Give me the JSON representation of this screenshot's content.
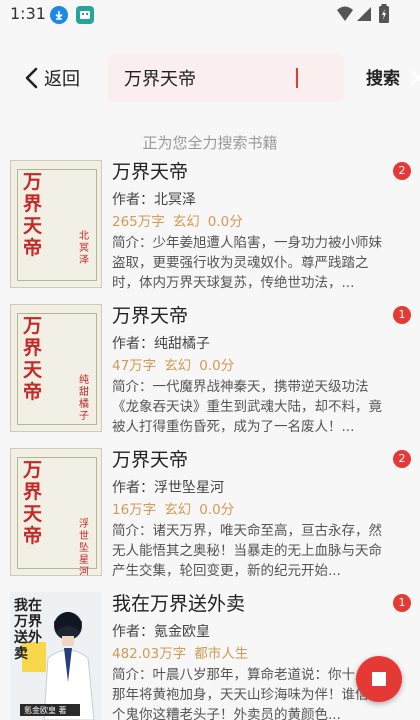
{
  "status_bar": {
    "time": "1:31",
    "icons": [
      "download-icon",
      "app-notification-icon",
      "wifi-icon",
      "signal-icon",
      "battery-icon"
    ]
  },
  "toolbar": {
    "back_label": "返回",
    "search_value": "万界天帝",
    "search_button": "搜索"
  },
  "status_text": "正为您全力搜索书籍",
  "colors": {
    "accent": "#e53935",
    "meta": "#d29a55",
    "search_bg": "#fbeeee"
  },
  "results": [
    {
      "title": "万界天帝",
      "author": "作者：北冥泽",
      "words": "265万字",
      "category": "玄幻",
      "score": "0.0分",
      "summary": "简介：少年姜旭遭人陷害，一身功力被小师妹盗取，更要强行收为灵魂奴仆。尊严践踏之时，体内万界天球复苏，传绝世功法，...",
      "badge": "2",
      "cover_title": "万界天帝",
      "cover_author": "北冥泽"
    },
    {
      "title": "万界天帝",
      "author": "作者：纯甜橘子",
      "words": "47万字",
      "category": "玄幻",
      "score": "0.0分",
      "summary": "简介：一代魔界战神秦天，携带逆天级功法《龙象吞天诀》重生到武魂大陆，却不料，竟被人打得重伤昏死，成为了一名废人！...",
      "badge": "1",
      "cover_title": "万界天帝",
      "cover_author": "纯甜橘子"
    },
    {
      "title": "万界天帝",
      "author": "作者：浮世坠星河",
      "words": "16万字",
      "category": "玄幻",
      "score": "0.0分",
      "summary": "简介：诸天万界，唯天命至高，亘古永存，然无人能悟其之奥秘！当暴走的无上血脉与天命产生交集，轮回变更，新的纪元开始...",
      "badge": "2",
      "cover_title": "万界天帝",
      "cover_author": "浮世坠星河"
    },
    {
      "title": "我在万界送外卖",
      "author": "作者：氪金欧皇",
      "words": "482.03万字",
      "category": "都市人生",
      "score": "",
      "summary": "简介：叶晨八岁那年，算命老道说：你十八岁那年将黄袍加身，天天山珍海味为伴！谁信你个鬼你这糟老头子！外卖员的黄颜色...",
      "badge": "1",
      "cover_title": "我在万界送外卖",
      "cover_author": "氪金欧皇 著"
    }
  ]
}
